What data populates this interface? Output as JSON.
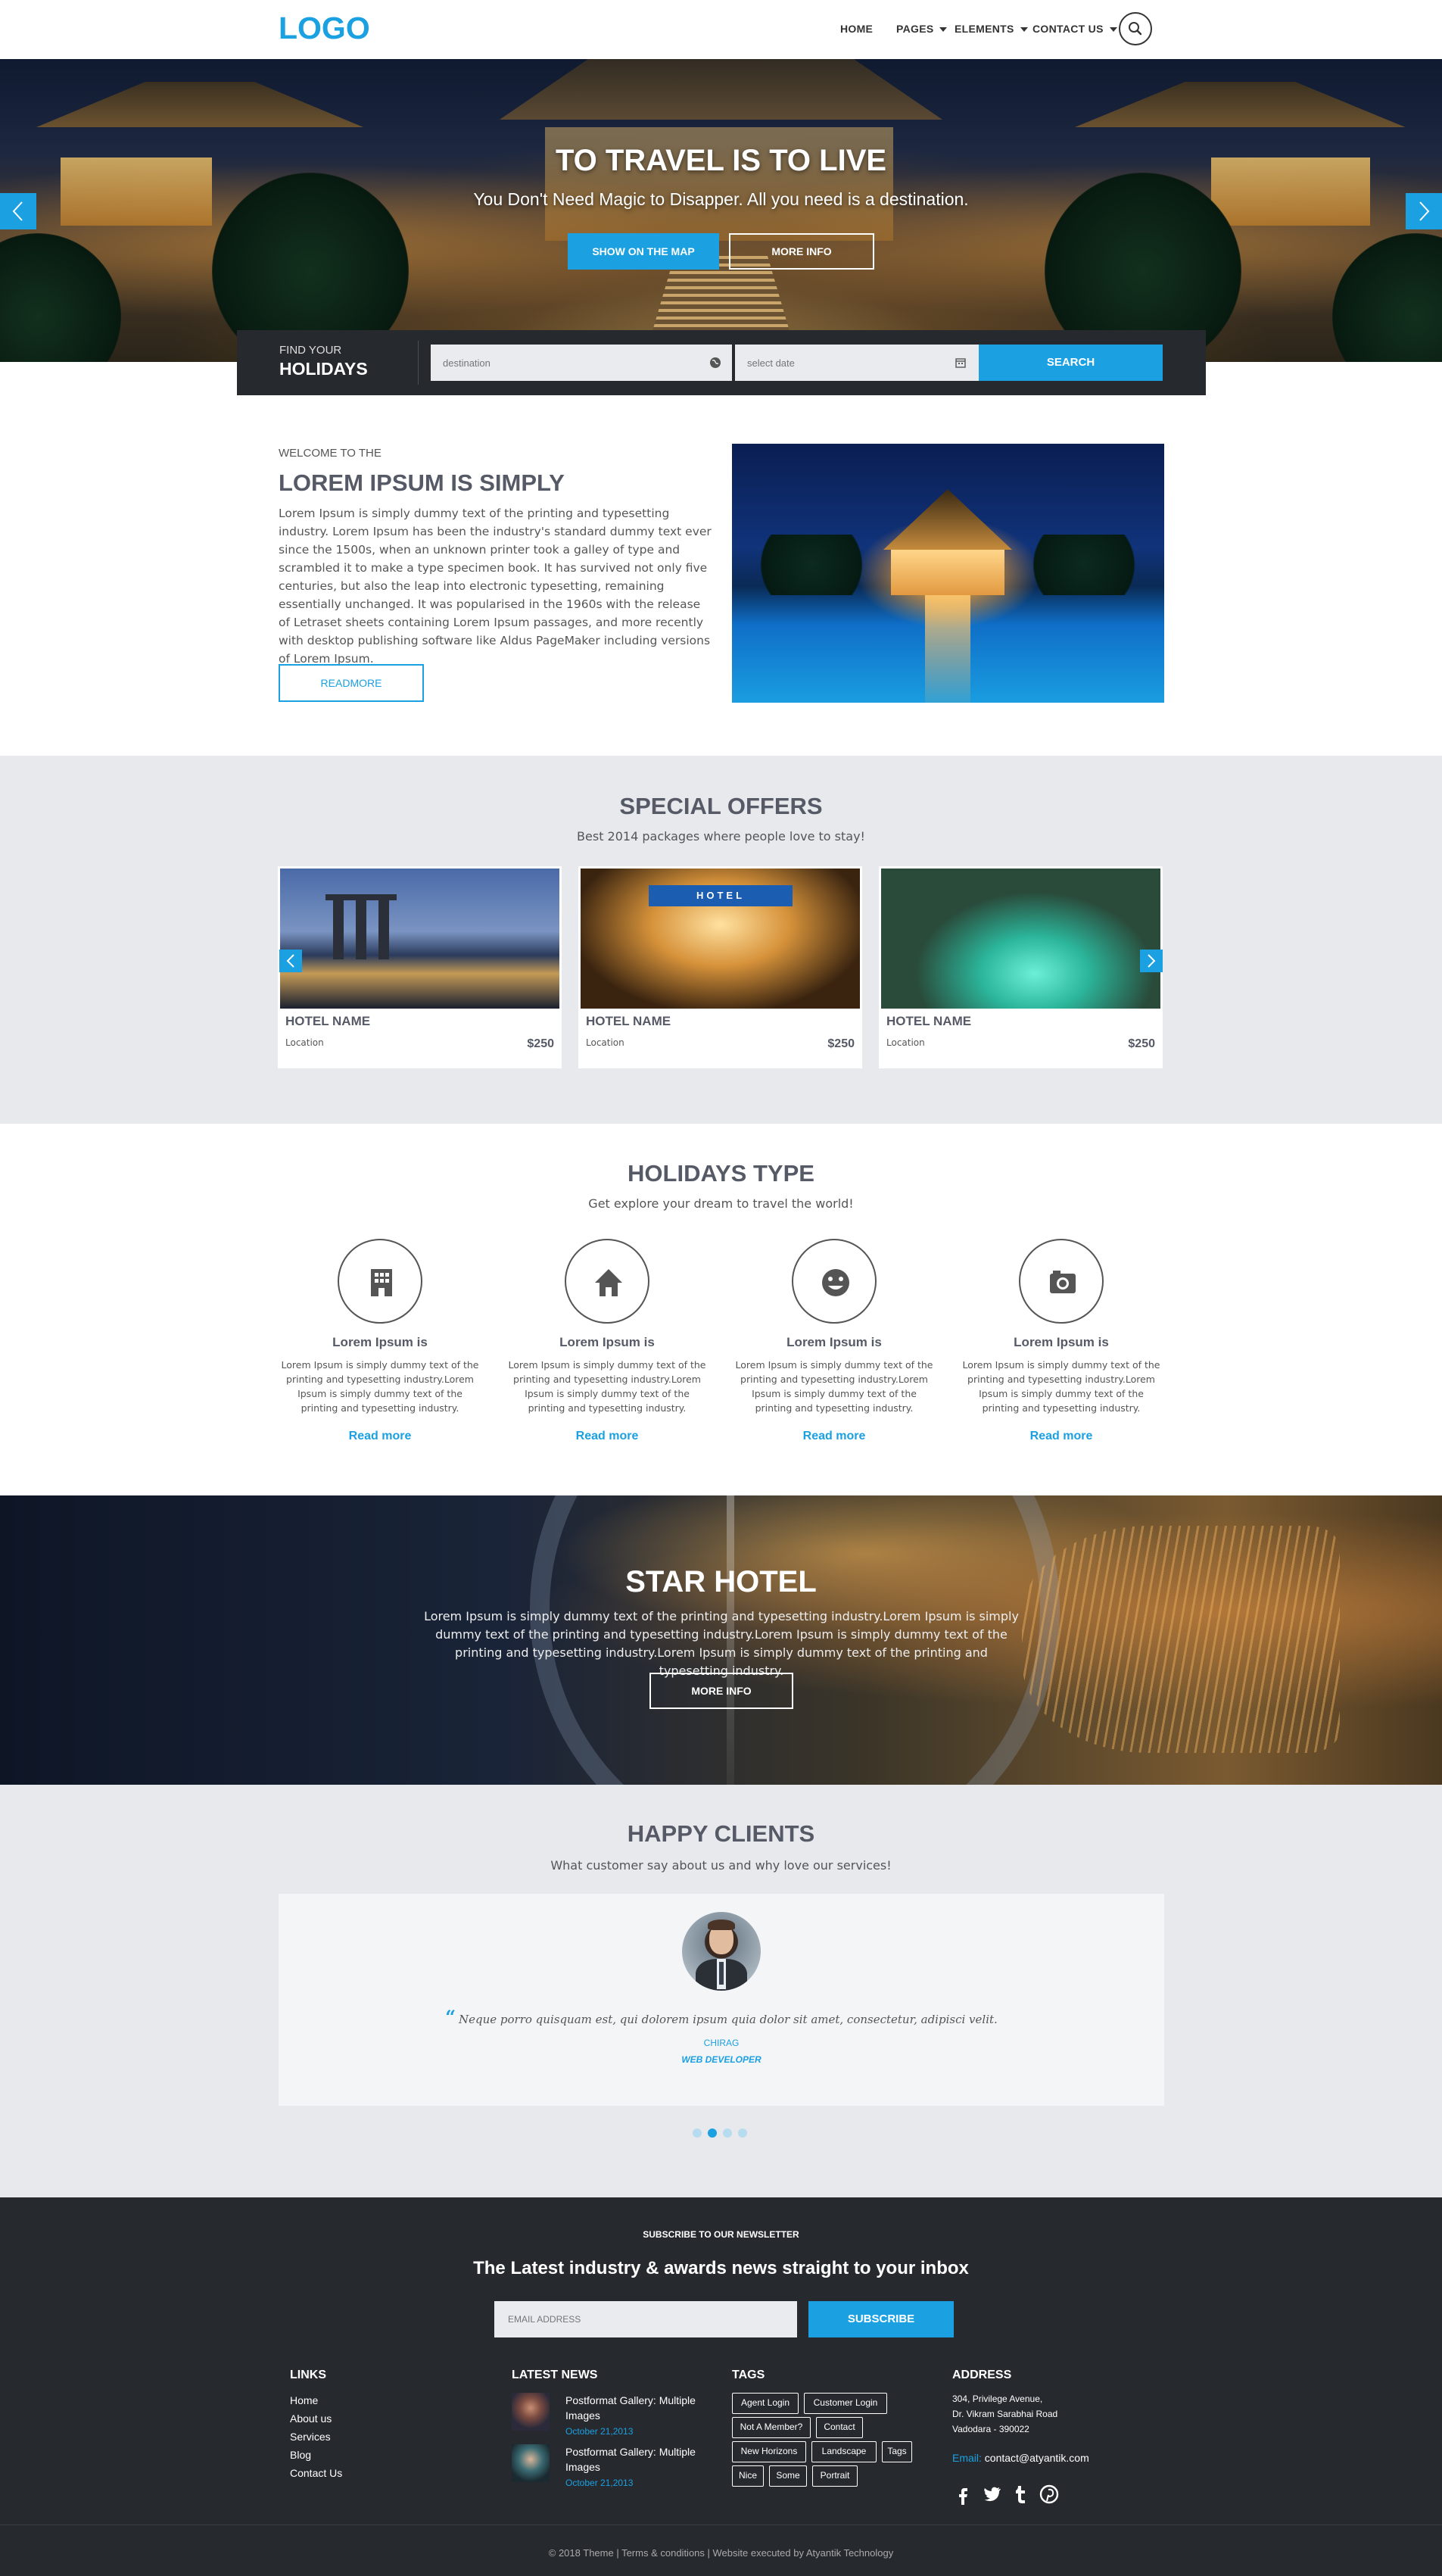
{
  "header": {
    "logo": "LOGO",
    "nav": [
      {
        "label": "HOME"
      },
      {
        "label": "PAGES"
      },
      {
        "label": "ELEMENTS"
      },
      {
        "label": "CONTACT US"
      }
    ]
  },
  "hero": {
    "title": "TO TRAVEL IS TO LIVE",
    "subtitle": "You Don't Need Magic to Disapper. All you need is a destination.",
    "btn_map": "SHOW ON THE MAP",
    "btn_more": "MORE INFO"
  },
  "search": {
    "find_small": "FIND YOUR",
    "find_big": "HOLIDAYS",
    "destination_placeholder": "destination",
    "date_placeholder": "select date",
    "button": "SEARCH"
  },
  "welcome": {
    "small": "WELCOME TO THE",
    "title": "LOREM IPSUM IS SIMPLY",
    "body": "Lorem Ipsum is simply dummy text of the printing and typesetting industry. Lorem Ipsum has been the industry's standard dummy text ever since the 1500s, when an unknown printer took a galley of type and scrambled it to make a type specimen book. It has survived not only five centuries, but also the leap into electronic typesetting, remaining essentially unchanged. It was popularised in the 1960s with the release of Letraset sheets containing Lorem Ipsum passages, and more recently with desktop publishing software like Aldus PageMaker including versions of Lorem Ipsum.",
    "button": "READMORE"
  },
  "offers": {
    "title": "SPECIAL OFFERS",
    "subtitle": "Best 2014 packages where people love to stay!",
    "cards": [
      {
        "name": "HOTEL NAME",
        "location": "Location",
        "price": "$250"
      },
      {
        "name": "HOTEL NAME",
        "location": "Location",
        "price": "$250"
      },
      {
        "name": "HOTEL NAME",
        "location": "Location",
        "price": "$250"
      }
    ],
    "hotel_sign": "HOTEL"
  },
  "holidays": {
    "title": "HOLIDAYS TYPE",
    "subtitle": "Get explore your dream to travel the world!",
    "items": [
      {
        "icon": "building-icon",
        "title": "Lorem Ipsum is",
        "text": "Lorem Ipsum is simply dummy text of the printing and typesetting industry.Lorem Ipsum is simply dummy text of the printing and typesetting industry.",
        "link": "Read more"
      },
      {
        "icon": "home-icon",
        "title": "Lorem Ipsum is",
        "text": "Lorem Ipsum is simply dummy text of the printing and typesetting industry.Lorem Ipsum is simply dummy text of the printing and typesetting industry.",
        "link": "Read more"
      },
      {
        "icon": "smiley-icon",
        "title": "Lorem Ipsum is",
        "text": "Lorem Ipsum is simply dummy text of the printing and typesetting industry.Lorem Ipsum is simply dummy text of the printing and typesetting industry.",
        "link": "Read more"
      },
      {
        "icon": "camera-icon",
        "title": "Lorem Ipsum is",
        "text": "Lorem Ipsum is simply dummy text of the printing and typesetting industry.Lorem Ipsum is simply dummy text of the printing and typesetting industry.",
        "link": "Read more"
      }
    ]
  },
  "star": {
    "title": "STAR HOTEL",
    "text": "Lorem Ipsum is simply dummy text of the printing and typesetting industry.Lorem Ipsum is simply dummy text of the printing and typesetting industry.Lorem Ipsum is simply dummy text of the printing and typesetting industry.Lorem Ipsum is simply dummy text of the printing and typesetting industry.",
    "button": "MORE INFO"
  },
  "clients": {
    "title": "HAPPY CLIENTS",
    "subtitle": "What customer say about us and why love our services!",
    "quote_mark": "“",
    "quote": "Neque porro quisquam est, qui dolorem ipsum quia dolor sit amet, consectetur, adipisci velit.",
    "name": "CHIRAG",
    "role": "WEB DEVELOPER",
    "active_slide": 2,
    "total_slides": 4
  },
  "footer": {
    "newsletter_label": "SUBSCRIBE TO OUR NEWSLETTER",
    "newsletter_title": "The Latest industry & awards news straight to your inbox",
    "email_placeholder": "EMAIL ADDRESS",
    "subscribe": "SUBSCRIBE",
    "links_head": "LINKS",
    "links": [
      "Home",
      "About us",
      "Services",
      "Blog",
      "Contact Us"
    ],
    "news_head": "LATEST NEWS",
    "news": [
      {
        "title": "Postformat Gallery: Multiple Images",
        "date": "October 21,2013"
      },
      {
        "title": "Postformat Gallery: Multiple Images",
        "date": "October 21,2013"
      }
    ],
    "tags_head": "TAGS",
    "tags": [
      "Agent Login",
      "Customer Login",
      "Not A Member?",
      "Contact",
      "New Horizons",
      "Landscape",
      "Tags",
      "Nice",
      "Some",
      "Portrait"
    ],
    "address_head": "ADDRESS",
    "address": [
      "304, Privilege Avenue,",
      "Dr. Vikram Sarabhai Road",
      "Vadodara - 390022"
    ],
    "email_label": "Email:",
    "email": "contact@atyantik.com",
    "social": [
      "facebook-icon",
      "twitter-icon",
      "tumblr-icon",
      "pinterest-icon"
    ],
    "copyright": "© 2018 Theme | Terms & conditions | Website executed by Atyantik Technology"
  },
  "colors": {
    "accent": "#1ba0e1",
    "dark": "#262a2f",
    "light_section": "#e7e9ec",
    "heading": "#555a66"
  }
}
